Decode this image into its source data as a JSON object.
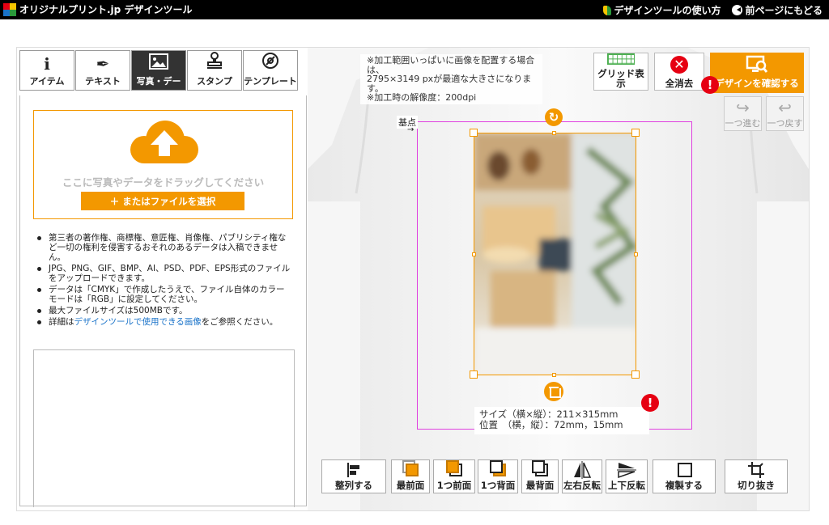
{
  "topbar": {
    "brand": "オリジナルプリント.jp デザインツール",
    "howto": "デザインツールの使い方",
    "back": "前ページにもどる"
  },
  "tabs": [
    {
      "label": "アイテム",
      "icon": "info-icon"
    },
    {
      "label": "テキスト",
      "icon": "pen-icon"
    },
    {
      "label": "写真・デー",
      "icon": "image-icon"
    },
    {
      "label": "スタンプ",
      "icon": "stamp-icon"
    },
    {
      "label": "テンプレート",
      "icon": "template-icon"
    }
  ],
  "upload": {
    "drop_text": "ここに写真やデータをドラッグしてください",
    "select_label": "＋ またはファイルを選択"
  },
  "notes": {
    "n1": "第三者の著作権、商標権、意匠権、肖像権、パブリシティ権など一切の権利を侵害するおそれのあるデータは入稿できません。",
    "n2": "JPG、PNG、GIF、BMP、AI、PSD、PDF、EPS形式のファイルをアップロードできます。",
    "n3": "データは「CMYK」で作成したうえで、ファイル自体のカラーモードは「RGB」に設定してください。",
    "n4": "最大ファイルサイズは500MBです。",
    "n5_pre": "詳細は",
    "n5_link": "デザインツールで使用できる画像",
    "n5_post": "をご参照ください。"
  },
  "canvas": {
    "info_l1": "※加工範囲いっぱいに画像を配置する場合は、",
    "info_l2": "2795×3149 pxが最適な大きさになります。",
    "info_l3": "※加工時の解像度：200dpi",
    "kiten": "基点",
    "size_line": "サイズ（横×縦）：211×315mm",
    "pos_line": "位置　（横，縦）：72mm，15mm"
  },
  "toolbar": {
    "grid": "グリッド表示",
    "clear": "全消去",
    "confirm": "デザインを確認する",
    "redo": "一つ進む",
    "undo": "一つ戻す"
  },
  "bottom_tools": {
    "align": "整列する",
    "front": "最前面",
    "forward": "1つ前面",
    "backward": "1つ背面",
    "back": "最背面",
    "flip_h": "左右反転",
    "flip_v": "上下反転",
    "duplicate": "複製する",
    "crop": "切り抜き"
  },
  "colors": {
    "accent": "#f39800",
    "warning": "#e60012",
    "print_area": "#e040e0"
  }
}
